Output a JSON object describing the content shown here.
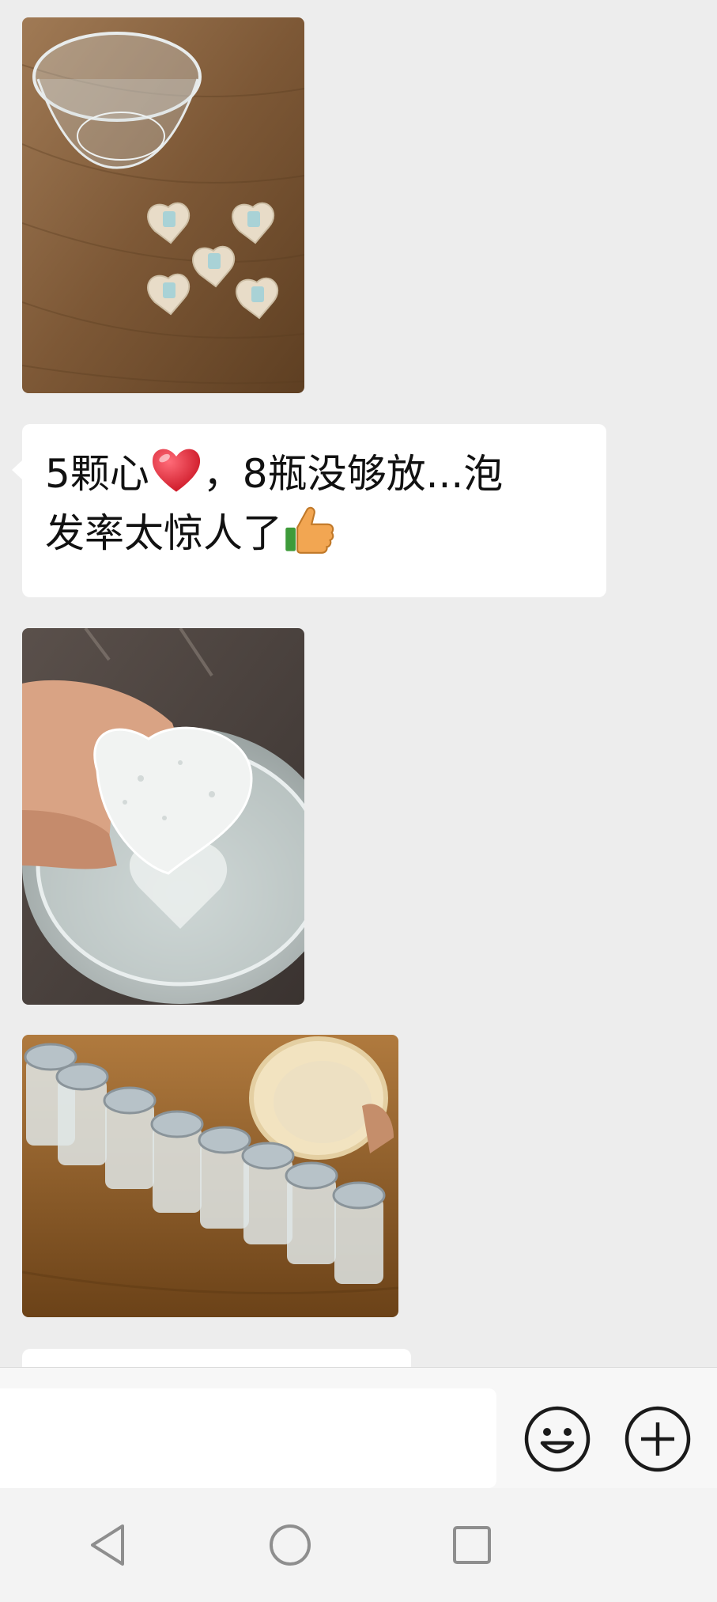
{
  "messages": [
    {
      "type": "image",
      "description_icon": "photo-hearts-on-table"
    },
    {
      "type": "text",
      "line1": "5颗心",
      "line1_after_heart": "，8瓶没够放...泡",
      "line2": "发率太惊人了"
    },
    {
      "type": "image",
      "description_icon": "photo-hand-holding-soaked-heart"
    },
    {
      "type": "image",
      "description_icon": "photo-row-of-jars"
    }
  ],
  "input": {
    "value": "",
    "placeholder": ""
  },
  "icons": {
    "emoji_button": "smiley-icon",
    "plus_button": "plus-circle-icon",
    "nav_back": "triangle-back-icon",
    "nav_home": "circle-home-icon",
    "nav_recent": "square-recents-icon",
    "heart_emoji": "red-heart-emoji",
    "thumbs_emoji": "thumbs-up-emoji"
  },
  "colors": {
    "chat_background": "#ededed",
    "bubble_background": "#ffffff",
    "text": "#111111",
    "heart": "#e02b3a",
    "thumb": "#f2a652"
  }
}
